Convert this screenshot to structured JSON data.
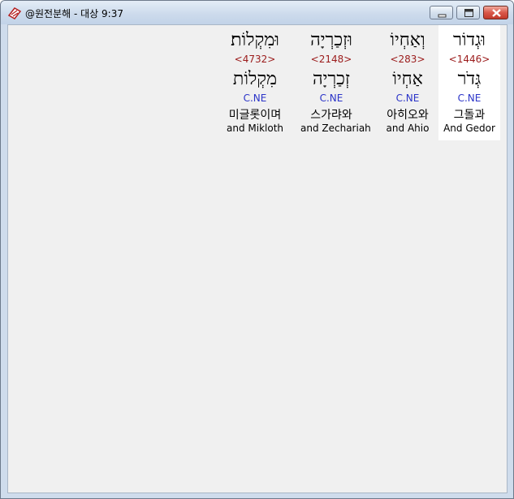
{
  "window": {
    "title": "@원전분해 - 대상 9:37",
    "app_icon": "bible-app-icon",
    "buttons": {
      "minimize": "minimize-icon",
      "maximize": "maximize-icon",
      "close": "close-icon"
    }
  },
  "colors": {
    "strong_number": "#9b1b1b",
    "grammar_code": "#2a33c8",
    "selected_background": "#ffffff",
    "client_background": "#f0f0f0"
  },
  "words": [
    {
      "hebrew": "וּגְדוֹר",
      "strong": "<1446>",
      "lemma": "גְּדֹר",
      "grammar": "C.NE",
      "korean": "그돌과",
      "english": "And Gedor",
      "selected": true
    },
    {
      "hebrew": "וְאַחְיוֹ",
      "strong": "<283>",
      "lemma": "אַחְיוֹ",
      "grammar": "C.NE",
      "korean": "아히오와",
      "english": "and Ahio",
      "selected": false
    },
    {
      "hebrew": "וּזְכַרְיָה",
      "strong": "<2148>",
      "lemma": "זְכַרְיָה",
      "grammar": "C.NE",
      "korean": "스가랴와",
      "english": "and Zechariah",
      "selected": false
    },
    {
      "hebrew": "וּמִקְלוֹת׃",
      "strong": "<4732>",
      "lemma": "מִקְלוֹת",
      "grammar": "C.NE",
      "korean": "미글롯이며",
      "english": "and Mikloth",
      "selected": false
    }
  ]
}
